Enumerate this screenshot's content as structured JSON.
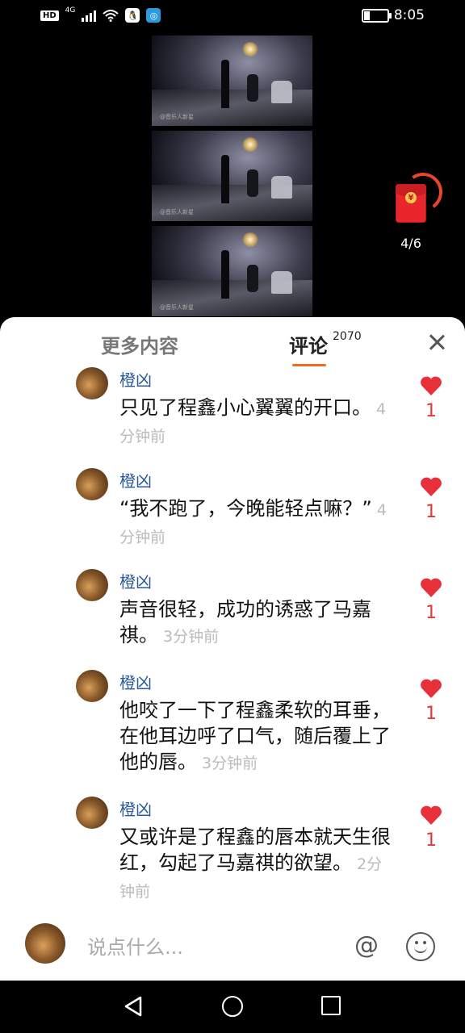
{
  "status_bar": {
    "hd": "HD",
    "network": "4G",
    "time": "8:05",
    "battery_level": 0.25
  },
  "video": {
    "watermark": "@音乐人新星"
  },
  "red_packet": {
    "coin_symbol": "¥",
    "count": "4/6"
  },
  "tabs": {
    "more": "更多内容",
    "comments": "评论",
    "comment_count": "2070"
  },
  "comments": [
    {
      "user": "橙凶",
      "text": "只见了程鑫小心翼翼的开口。",
      "time": "4分钟前",
      "likes": "1"
    },
    {
      "user": "橙凶",
      "text": "“我不跑了，今晚能轻点嘛？”",
      "time": "4分钟前",
      "likes": "1"
    },
    {
      "user": "橙凶",
      "text": "声音很轻，成功的诱惑了马嘉祺。",
      "time": "3分钟前",
      "likes": "1"
    },
    {
      "user": "橙凶",
      "text": "他咬了一下了程鑫柔软的耳垂，在他耳边呼了口气，随后覆上了他的唇。",
      "time": "3分钟前",
      "likes": "1"
    },
    {
      "user": "橙凶",
      "text": "又或许是了程鑫的唇本就天生很红，勾起了马嘉祺的欲望。",
      "time": "2分钟前",
      "likes": "1"
    }
  ],
  "input": {
    "placeholder": "说点什么..."
  },
  "colors": {
    "accent": "#f26b1d",
    "like": "#e23a3a",
    "username": "#2a5a9c"
  }
}
